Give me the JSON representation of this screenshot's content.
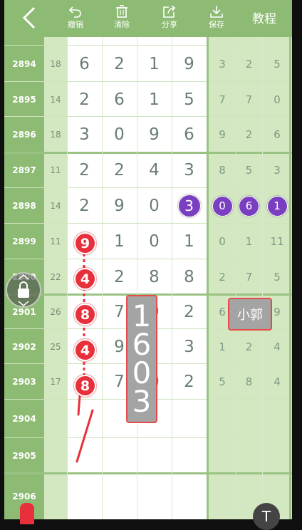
{
  "topbar": {
    "buttons": [
      {
        "label": "撤销",
        "icon": "undo-icon"
      },
      {
        "label": "清除",
        "icon": "trash-icon"
      },
      {
        "label": "分享",
        "icon": "share-icon"
      },
      {
        "label": "保存",
        "icon": "download-icon"
      }
    ],
    "title": "教程"
  },
  "colors": {
    "green_dark": "#8dbb73",
    "green_light": "#d3e7c0",
    "purple_ball": "#7a3fc1",
    "red_mark": "#e8303c",
    "label_grey": "#a4a4a4"
  },
  "rows": [
    {
      "issue": "2894",
      "sum": "18",
      "digits": [
        "6",
        "2",
        "1",
        "9"
      ],
      "tail": [
        "3",
        "2",
        "5"
      ]
    },
    {
      "issue": "2895",
      "sum": "14",
      "digits": [
        "2",
        "6",
        "1",
        "5"
      ],
      "tail": [
        "7",
        "7",
        "0"
      ]
    },
    {
      "issue": "2896",
      "sum": "18",
      "digits": [
        "3",
        "0",
        "9",
        "6"
      ],
      "tail": [
        "9",
        "2",
        "6"
      ]
    },
    {
      "issue": "2897",
      "sum": "11",
      "digits": [
        "2",
        "2",
        "4",
        "3"
      ],
      "tail": [
        "8",
        "5",
        "3"
      ]
    },
    {
      "issue": "2898",
      "sum": "14",
      "digits": [
        "2",
        "9",
        "0",
        "3"
      ],
      "tail": [
        "0",
        "6",
        "1"
      ]
    },
    {
      "issue": "2899",
      "sum": "11",
      "digits": [
        "",
        "1",
        "0",
        "1"
      ],
      "tail": [
        "0",
        "1",
        "11"
      ]
    },
    {
      "issue": "2900",
      "sum": "22",
      "digits": [
        "",
        "2",
        "8",
        "8"
      ],
      "tail": [
        "2",
        "7",
        "5"
      ]
    },
    {
      "issue": "2901",
      "sum": "26",
      "digits": [
        "",
        "7",
        "9",
        "2"
      ],
      "tail": [
        "6",
        "",
        "9"
      ]
    },
    {
      "issue": "2902",
      "sum": "25",
      "digits": [
        "",
        "9",
        "",
        "3"
      ],
      "tail": [
        "1",
        "2",
        "4"
      ]
    },
    {
      "issue": "2903",
      "sum": "17",
      "digits": [
        "",
        "7",
        "0",
        "2"
      ],
      "tail": [
        "5",
        "8",
        "4"
      ]
    },
    {
      "issue": "2904",
      "sum": "",
      "digits": [
        "",
        "",
        "",
        ""
      ],
      "tail": [
        "",
        "",
        ""
      ]
    },
    {
      "issue": "2905",
      "sum": "",
      "digits": [
        "",
        "",
        "",
        ""
      ],
      "tail": [
        "",
        "",
        ""
      ]
    },
    {
      "issue": "2906",
      "sum": "",
      "digits": [
        "",
        "",
        "",
        ""
      ],
      "tail": [
        "",
        "",
        ""
      ]
    }
  ],
  "red_marks": [
    "9",
    "4",
    "8",
    "4",
    "8"
  ],
  "vertical_label": [
    "1",
    "6",
    "0",
    "3"
  ],
  "name_label": "小郭",
  "float_t": "T"
}
